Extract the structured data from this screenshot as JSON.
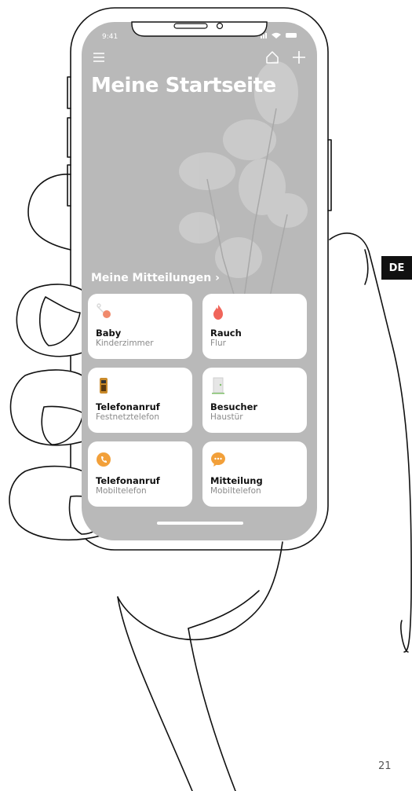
{
  "status_bar": {
    "time": "9:41"
  },
  "header": {
    "title": "Meine Startseite"
  },
  "notifications_link": {
    "label": "Meine Mitteilungen",
    "chevron": "›"
  },
  "cards": [
    {
      "title": "Baby",
      "subtitle": "Kinderzimmer",
      "icon": "baby-bottle-icon",
      "color": "#f08a6c"
    },
    {
      "title": "Rauch",
      "subtitle": "Flur",
      "icon": "flame-icon",
      "color": "#f0655a"
    },
    {
      "title": "Telefonanruf",
      "subtitle": "Festnetztelefon",
      "icon": "landline-phone-icon",
      "color": "#c98a2a"
    },
    {
      "title": "Besucher",
      "subtitle": "Haustür",
      "icon": "door-icon",
      "color": "#7fbf6a"
    },
    {
      "title": "Telefonanruf",
      "subtitle": "Mobiltelefon",
      "icon": "phone-icon",
      "color": "#f2a03a"
    },
    {
      "title": "Mitteilung",
      "subtitle": "Mobiltelefon",
      "icon": "message-icon",
      "color": "#f2a03a"
    }
  ],
  "language_badge": "DE",
  "page_number": "21"
}
